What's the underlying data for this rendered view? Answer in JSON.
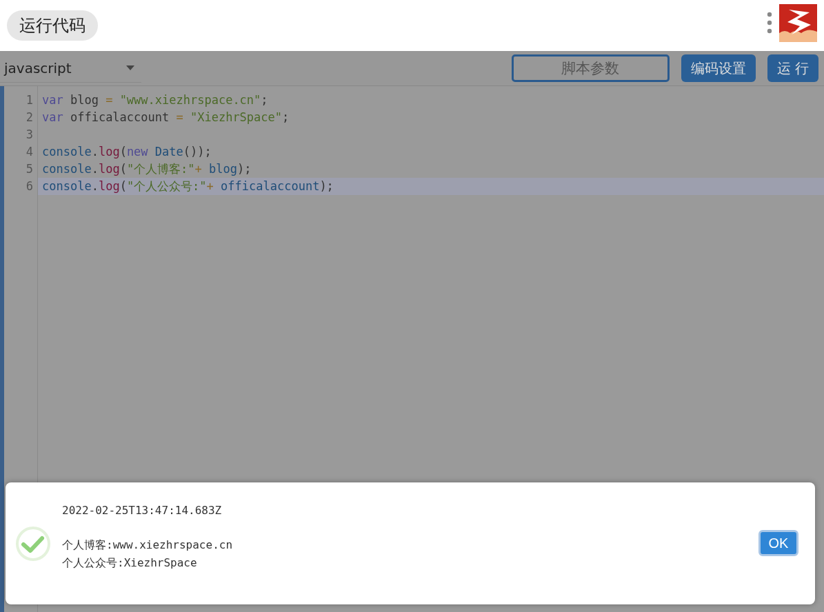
{
  "header": {
    "title": "运行代码"
  },
  "toolbar": {
    "language": "javascript",
    "args_placeholder": "脚本参数",
    "buttons": [
      "编码设置",
      "运 行"
    ]
  },
  "editor": {
    "lines": [
      {
        "number": "1",
        "active": false,
        "tokens": [
          {
            "kind": "keyword",
            "text": "var"
          },
          {
            "kind": "plain",
            "text": " blog "
          },
          {
            "kind": "operator",
            "text": "= "
          },
          {
            "kind": "string",
            "text": "\"www.xiezhrspace.cn\""
          },
          {
            "kind": "plain",
            "text": ";"
          }
        ]
      },
      {
        "number": "2",
        "active": false,
        "tokens": [
          {
            "kind": "keyword",
            "text": "var"
          },
          {
            "kind": "plain",
            "text": " officalaccount "
          },
          {
            "kind": "operator",
            "text": "= "
          },
          {
            "kind": "string",
            "text": "\"XiezhrSpace\""
          },
          {
            "kind": "plain",
            "text": ";"
          }
        ]
      },
      {
        "number": "3",
        "active": false
      },
      {
        "number": "4",
        "active": false,
        "tokens": [
          {
            "kind": "variable",
            "text": "console"
          },
          {
            "kind": "plain",
            "text": "."
          },
          {
            "kind": "property",
            "text": "log"
          },
          {
            "kind": "plain",
            "text": "("
          },
          {
            "kind": "keyword",
            "text": "new "
          },
          {
            "kind": "variable",
            "text": "Date"
          },
          {
            "kind": "plain",
            "text": "());"
          }
        ]
      },
      {
        "number": "5",
        "active": false,
        "tokens": [
          {
            "kind": "variable",
            "text": "console"
          },
          {
            "kind": "plain",
            "text": "."
          },
          {
            "kind": "property",
            "text": "log"
          },
          {
            "kind": "plain",
            "text": "("
          },
          {
            "kind": "string",
            "text": "\"个人博客:\""
          },
          {
            "kind": "operator",
            "text": "+ "
          },
          {
            "kind": "variable",
            "text": "blog"
          },
          {
            "kind": "plain",
            "text": ");"
          }
        ]
      },
      {
        "number": "6",
        "active": true,
        "tokens": [
          {
            "kind": "variable",
            "text": "console"
          },
          {
            "kind": "plain",
            "text": "."
          },
          {
            "kind": "property",
            "text": "log"
          },
          {
            "kind": "plain",
            "text": "("
          },
          {
            "kind": "string",
            "text": "\"个人公众号:\""
          },
          {
            "kind": "operator",
            "text": "+ "
          },
          {
            "kind": "variable",
            "text": "officalaccount"
          },
          {
            "kind": "plain",
            "text": ");"
          }
        ]
      }
    ]
  },
  "dialog": {
    "kind": "success",
    "output": [
      [
        "2022-02-25T13:47:14.683Z"
      ],
      [
        "个人博客:www.xiezhrspace.cn",
        "个人公众号:XiezhrSpace"
      ]
    ],
    "button": "OK"
  }
}
